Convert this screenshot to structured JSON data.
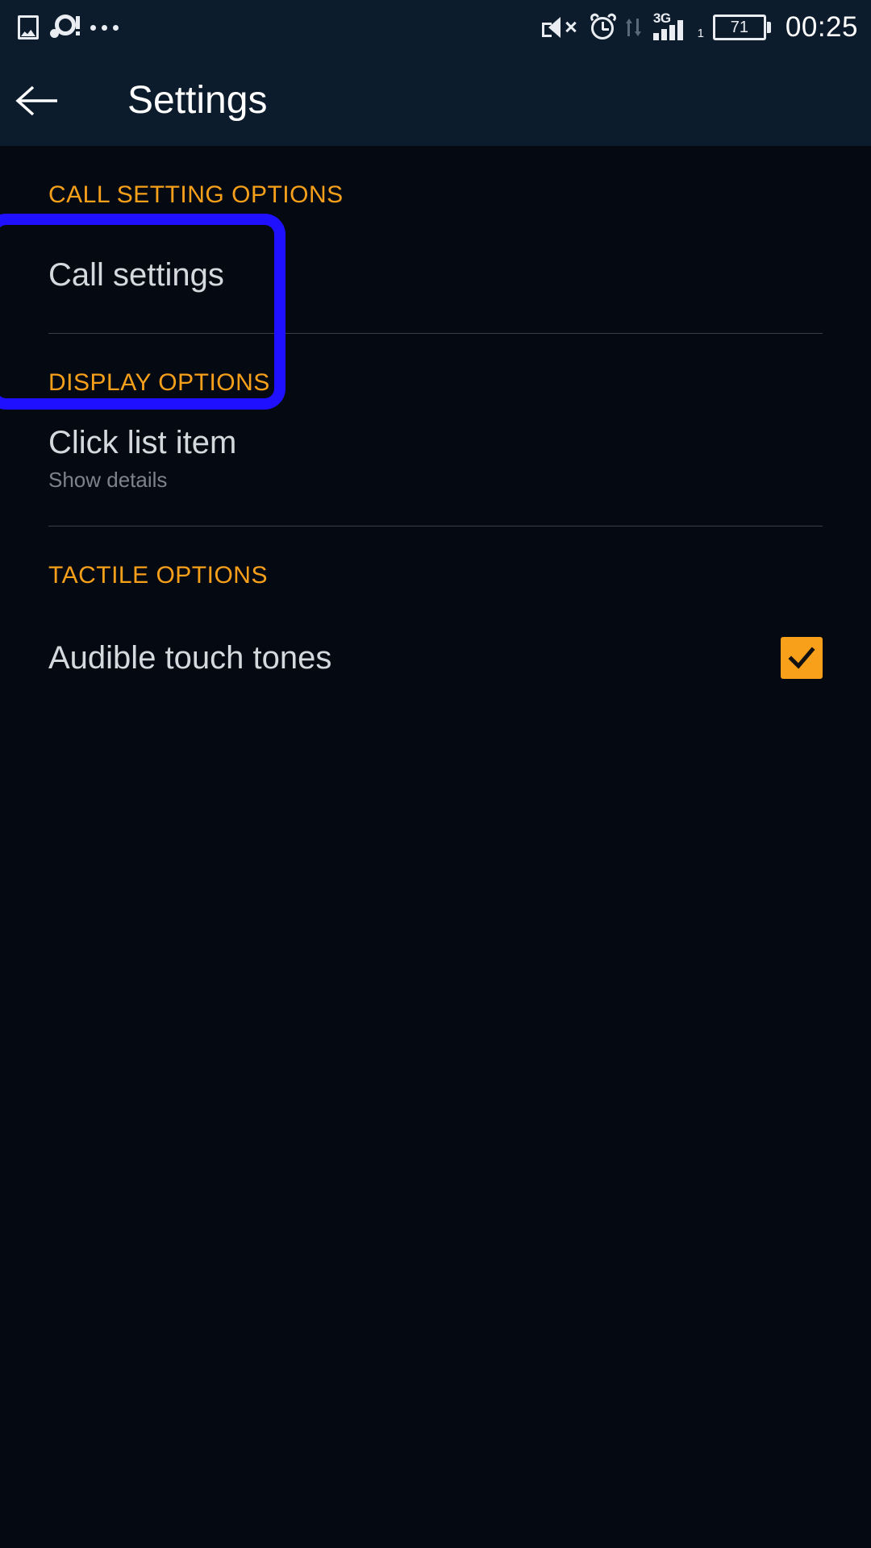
{
  "status_bar": {
    "left_icons": [
      {
        "name": "screenshot-icon",
        "label": "Screenshot"
      },
      {
        "name": "disc-warning-icon",
        "label": "Storage alert"
      },
      {
        "name": "more-notifications-icon",
        "label": "More notifications"
      }
    ],
    "right_icons": [
      {
        "name": "mute-icon",
        "label": "Silent mode"
      },
      {
        "name": "alarm-icon",
        "label": "Alarm set"
      },
      {
        "name": "data-transfer-icon",
        "label": "Data transfer"
      }
    ],
    "network_type": "3G",
    "signal_sub": "1",
    "battery_level": "71",
    "clock": "00:25"
  },
  "appbar": {
    "back_icon": "back-arrow-icon",
    "title": "Settings"
  },
  "sections": [
    {
      "header": "CALL SETTING OPTIONS",
      "rows": [
        {
          "title": "Call settings",
          "subtitle": "",
          "control": "none",
          "highlighted": true
        }
      ]
    },
    {
      "header": "DISPLAY OPTIONS",
      "rows": [
        {
          "title": "Click list item",
          "subtitle": "Show details",
          "control": "none",
          "highlighted": false
        }
      ]
    },
    {
      "header": "TACTILE OPTIONS",
      "rows": [
        {
          "title": "Audible touch tones",
          "subtitle": "",
          "control": "checkbox",
          "checked": true,
          "highlighted": false
        }
      ]
    }
  ],
  "colors": {
    "background": "#050a12",
    "chrome": "#0d1c2c",
    "accent": "#f9a01b",
    "highlight": "#1f10ff",
    "primary_text": "#d5d8dc",
    "secondary_text": "#7d838b"
  }
}
